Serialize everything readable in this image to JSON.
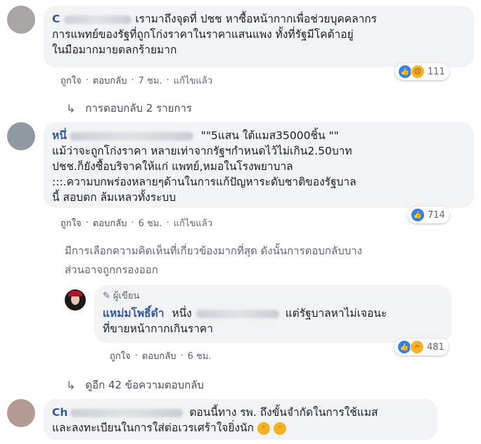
{
  "comments": [
    {
      "name_visible": "C",
      "name_suffix": "",
      "text_line1": "เรามาถึงจุดที่ ปชช หาซื้อหน้ากากเพื่อช่วยบุคคลากร",
      "text_line2": "การแพทย์ของรัฐที่ถูกโก่งราคาในราคาแสนแพง ทั้งที่รัฐมีโคต้าอยู่",
      "text_line3": "ในมือมากมายตลกร้ายมาก",
      "like": "ถูกใจ",
      "reply": "ตอบกลับ",
      "time": "7 ชม.",
      "edited": "แก้ไขแล้ว",
      "reaction_count": "111",
      "reactions": [
        "like-icon",
        "sad-icon"
      ]
    },
    {
      "name_visible": "หนึ่",
      "quote": "\"\"5แสน ใต้แมส35000ชิ้น \"\"",
      "text_line1": "แม้ว่าจะถูกโก่งราคา หลายเท่าจากรัฐฯกำหนดไว้ไม่เกิน2.50บาท",
      "text_line2": "ปชช.ก็ยังซื้อบริจาคให้แก่ แพทย์,หมอในโรงพยาบาล",
      "text_line3": ":::.ความบกพร่องหลายๆด้านในการแก้ปัญหาระดับชาติของรัฐบาล",
      "text_line4": "นี้ สอบตก ล้มเหลวทั้งระบบ",
      "like": "ถูกใจ",
      "reply": "ตอบกลับ",
      "time": "6 ชม.",
      "edited": "แก้ไขแล้ว",
      "reaction_count": "714",
      "reactions": [
        "like-icon"
      ]
    },
    {
      "author_tag": "ผู้เขียน",
      "name": "แหม่มโพธิ์ดำ",
      "name_tail": "หนึ่ง",
      "text_line1": "แต่รัฐบาลหาไม่เจอนะ",
      "text_line2": "ที่ขายหน้ากากเกินราคา",
      "like": "ถูกใจ",
      "reply": "ตอบกลับ",
      "time": "6 ชม.",
      "reaction_count": "481",
      "reactions": [
        "like-icon",
        "haha-icon"
      ]
    },
    {
      "name_visible": "Ch",
      "text_line1": "ตอนนี้ทาง รพ. ถึงขั้นจำกัดในการใช้แมส",
      "text_line2": "และลงทะเบียนในการใส่ต่อเวรเศร้าใจยิ่งนัก"
    }
  ],
  "separator": "·",
  "replies_link": "การตอบกลับ 2 รายการ",
  "notice_line1": "มีการเลือกความคิดเห็นที่เกี่ยวข้องมากที่สุด ดังนั้นการตอบกลับบาง",
  "notice_line2": "ส่วนอาจถูกกรองออก",
  "more_replies": "ดูอีก 42 ข้อความตอบกลับ"
}
